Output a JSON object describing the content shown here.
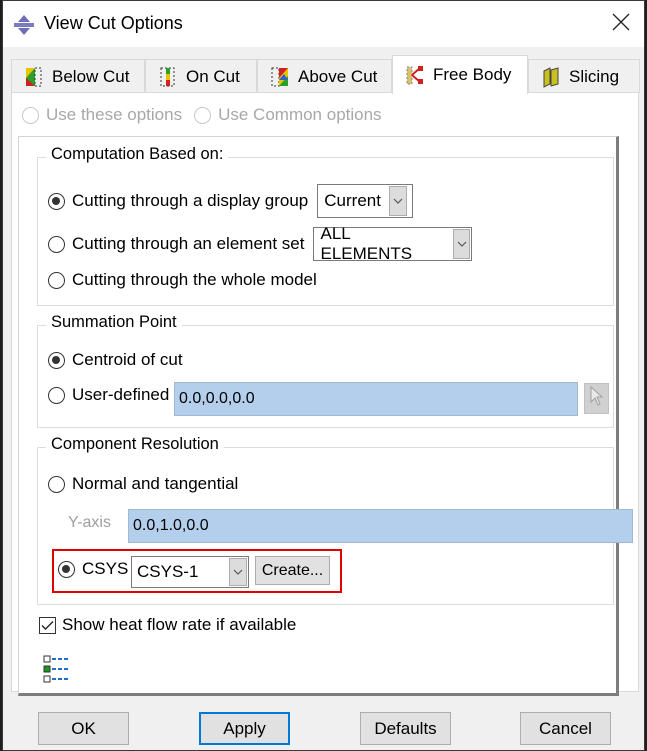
{
  "window": {
    "title": "View Cut Options",
    "icon": "view-cut-app-icon",
    "close_icon": "close-icon"
  },
  "tabs": [
    {
      "label": "Below Cut",
      "icon": "below-cut-icon",
      "active": false
    },
    {
      "label": "On Cut",
      "icon": "on-cut-icon",
      "active": false
    },
    {
      "label": "Above Cut",
      "icon": "above-cut-icon",
      "active": false
    },
    {
      "label": "Free Body",
      "icon": "free-body-icon",
      "active": true
    },
    {
      "label": "Slicing",
      "icon": "slicing-icon",
      "active": false
    }
  ],
  "options_source": {
    "use_these": {
      "label": "Use these options",
      "checked": false,
      "disabled": true
    },
    "use_common": {
      "label": "Use Common options",
      "checked": false,
      "disabled": true
    }
  },
  "computation": {
    "title": "Computation Based on:",
    "display_group": {
      "label": "Cutting through a display group",
      "checked": true,
      "select_value": "Current"
    },
    "element_set": {
      "label": "Cutting through an element set",
      "checked": false,
      "select_value": "ALL ELEMENTS"
    },
    "whole_model": {
      "label": "Cutting through the whole model",
      "checked": false
    }
  },
  "summation": {
    "title": "Summation Point",
    "centroid": {
      "label": "Centroid of cut",
      "checked": true
    },
    "user_defined": {
      "label": "User-defined",
      "checked": false,
      "value": "0.0,0.0,0.0"
    },
    "pick_icon": "cursor-pick-icon"
  },
  "component": {
    "title": "Component Resolution",
    "normal_tangential": {
      "label": "Normal and tangential",
      "checked": false
    },
    "y_axis": {
      "label": "Y-axis",
      "value": "0.0,1.0,0.0"
    },
    "csys": {
      "label": "CSYS",
      "checked": true,
      "select_value": "CSYS-1",
      "create_label": "Create..."
    },
    "highlight_color": "#e00000"
  },
  "heat_flow": {
    "label": "Show heat flow rate if available",
    "checked": true
  },
  "legend_icon": "legend-list-icon",
  "buttons": {
    "ok": "OK",
    "apply": "Apply",
    "defaults": "Defaults",
    "cancel": "Cancel"
  },
  "colors": {
    "field_blue": "#b4cfec",
    "focus_blue": "#0078d7"
  }
}
